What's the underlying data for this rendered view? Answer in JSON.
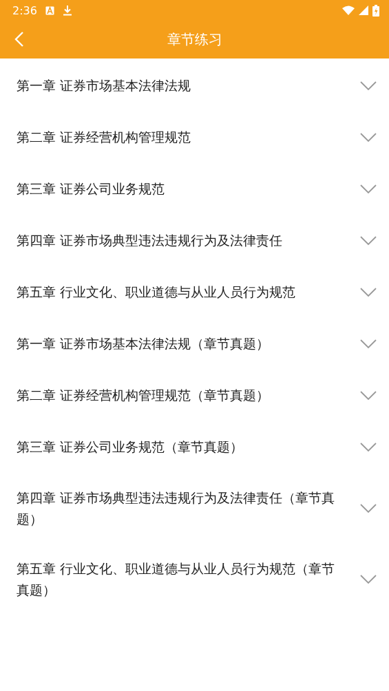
{
  "status_bar": {
    "time": "2:36"
  },
  "toolbar": {
    "title": "章节练习"
  },
  "chapters": [
    {
      "title": "第一章 证券市场基本法律法规",
      "expanded": false
    },
    {
      "title": "第二章 证券经营机构管理规范",
      "expanded": false
    },
    {
      "title": "第三章 证券公司业务规范",
      "expanded": false
    },
    {
      "title": "第四章 证券市场典型违法违规行为及法律责任",
      "expanded": false
    },
    {
      "title": "第五章 行业文化、职业道德与从业人员行为规范",
      "expanded": false
    },
    {
      "title": "第一章 证券市场基本法律法规（章节真题）",
      "expanded": false
    },
    {
      "title": "第二章 证券经营机构管理规范（章节真题）",
      "expanded": false
    },
    {
      "title": "第三章 证券公司业务规范（章节真题）",
      "expanded": false
    },
    {
      "title": "第四章 证券市场典型违法违规行为及法律责任（章节真题）",
      "expanded": false
    },
    {
      "title": "第五章 行业文化、职业道德与从业人员行为规范（章节真题）",
      "expanded": false
    }
  ]
}
